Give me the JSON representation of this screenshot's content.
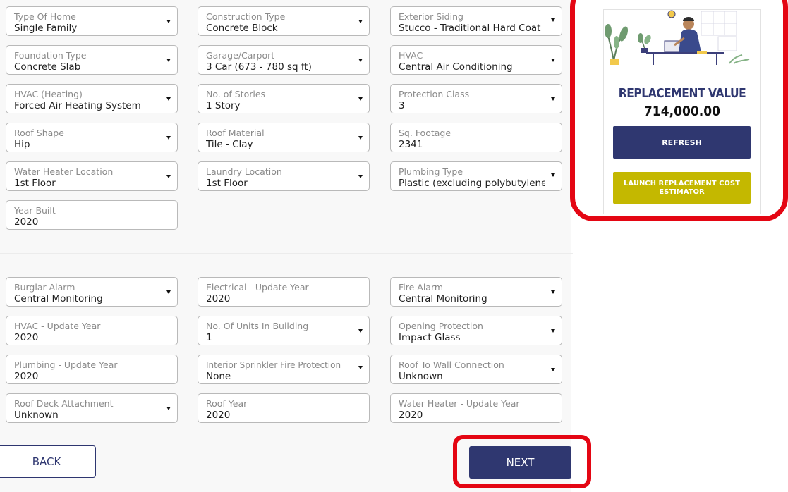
{
  "property_fields": [
    {
      "label": "Type Of Home",
      "value": "Single Family"
    },
    {
      "label": "Construction Type",
      "value": "Concrete Block"
    },
    {
      "label": "Exterior Siding",
      "value": "Stucco - Traditional Hard Coat"
    },
    {
      "label": "Foundation Type",
      "value": "Concrete Slab"
    },
    {
      "label": "Garage/Carport",
      "value": "3 Car (673 - 780 sq ft)"
    },
    {
      "label": "HVAC",
      "value": "Central Air Conditioning"
    },
    {
      "label": "HVAC (Heating)",
      "value": "Forced Air Heating System"
    },
    {
      "label": "No. of Stories",
      "value": "1 Story"
    },
    {
      "label": "Protection Class",
      "value": "3"
    },
    {
      "label": "Roof Shape",
      "value": "Hip"
    },
    {
      "label": "Roof Material",
      "value": "Tile - Clay"
    },
    {
      "label": "Sq. Footage",
      "value": "2341"
    },
    {
      "label": "Water Heater Location",
      "value": "1st Floor"
    },
    {
      "label": "Laundry Location",
      "value": "1st Floor"
    },
    {
      "label": "Plumbing Type",
      "value": "Plastic (excluding polybutylene)"
    },
    {
      "label": "Year Built",
      "value": "2020"
    }
  ],
  "update_fields": [
    {
      "label": "Burglar Alarm",
      "value": "Central Monitoring"
    },
    {
      "label": "Electrical - Update Year",
      "value": "2020"
    },
    {
      "label": "Fire Alarm",
      "value": "Central Monitoring"
    },
    {
      "label": "HVAC - Update Year",
      "value": "2020"
    },
    {
      "label": "No. Of Units In Building",
      "value": "1"
    },
    {
      "label": "Opening Protection",
      "value": "Impact Glass"
    },
    {
      "label": "Plumbing - Update Year",
      "value": "2020"
    },
    {
      "label": "Interior Sprinkler Fire Protection",
      "value": "None"
    },
    {
      "label": "Roof To Wall Connection",
      "value": "Unknown"
    },
    {
      "label": "Roof Deck Attachment",
      "value": "Unknown"
    },
    {
      "label": "Roof Year",
      "value": "2020"
    },
    {
      "label": "Water Heater - Update Year",
      "value": "2020"
    }
  ],
  "buttons": {
    "back": "BACK",
    "next": "NEXT"
  },
  "replacement_card": {
    "title": "REPLACEMENT VALUE",
    "amount": "714,000.00",
    "refresh_label": "REFRESH",
    "launch_label": "LAUNCH REPLACEMENT COST ESTIMATOR",
    "illustration": "person-at-laptop-illustration"
  },
  "colors": {
    "navy": "#2f3770",
    "olive": "#c4b800",
    "highlight_red": "#e40613",
    "border_gray": "#b9b9b9"
  }
}
